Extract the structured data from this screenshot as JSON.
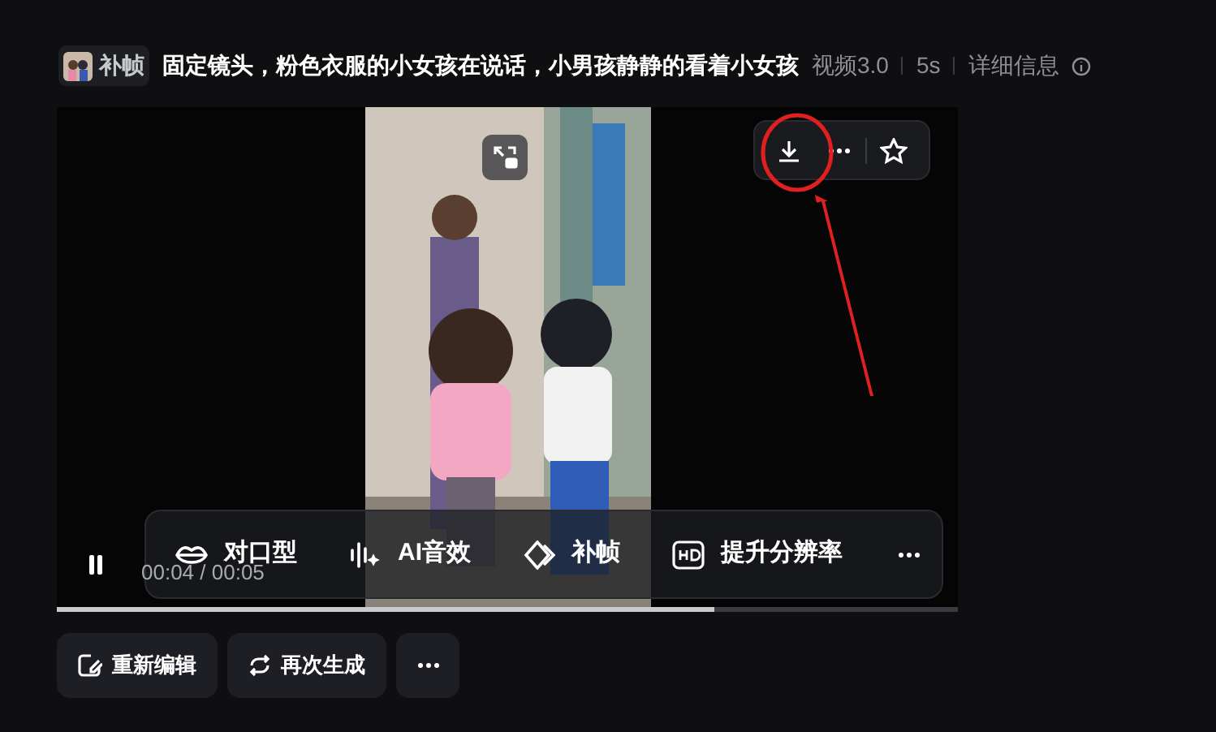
{
  "header": {
    "tag": "补帧",
    "prompt": "固定镜头，粉色衣服的小女孩在说话，小男孩静静的看着小女孩",
    "model": "视频3.0",
    "duration": "5s",
    "details": "详细信息"
  },
  "player": {
    "time": "00:04 / 00:05",
    "playing": true,
    "level": 0.73
  },
  "tools": [
    {
      "kind": "lips",
      "label": "对口型"
    },
    {
      "kind": "sound",
      "label": "AI音效"
    },
    {
      "kind": "frames",
      "label": "补帧"
    },
    {
      "kind": "hd",
      "label": "提升分辨率"
    }
  ],
  "actions": [
    {
      "kind": "edit",
      "label": "重新编辑"
    },
    {
      "kind": "regen",
      "label": "再次生成"
    }
  ],
  "annotation": {
    "shown": true
  }
}
